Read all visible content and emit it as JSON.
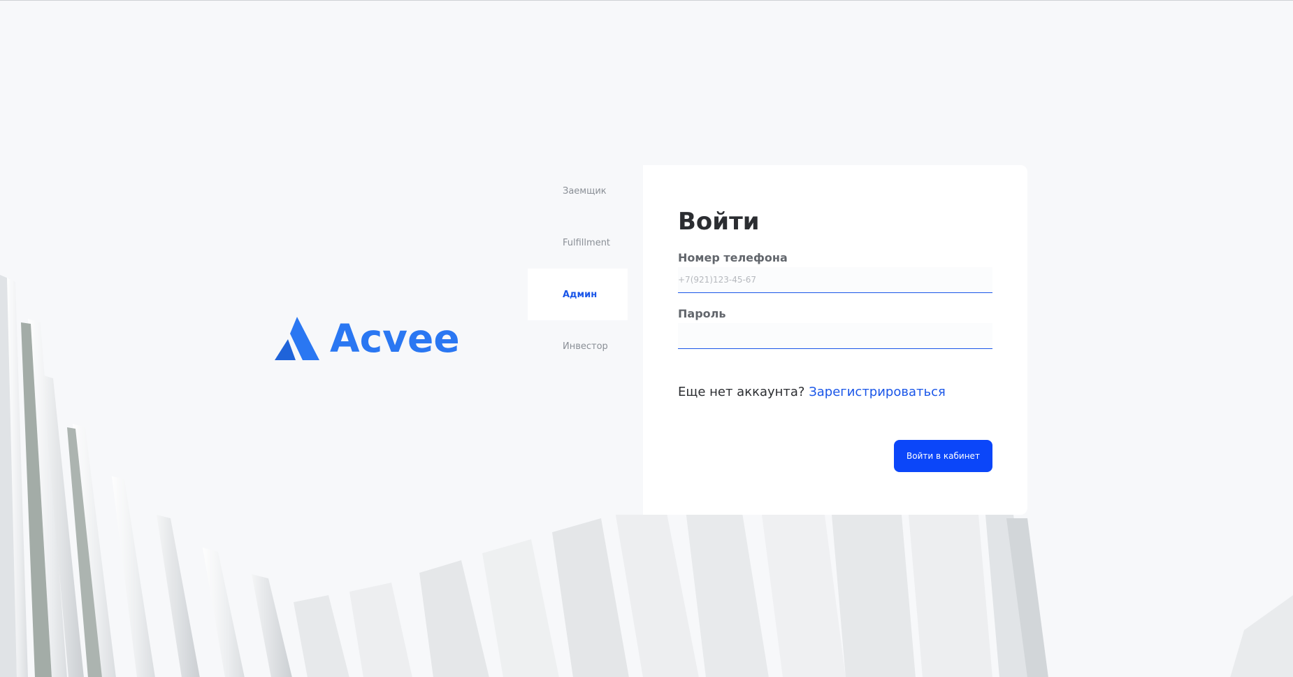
{
  "brand": {
    "name": "Acvee",
    "color": "#2a77f2",
    "icon": "acvee-logo-mark"
  },
  "tabs": [
    {
      "label": "Заемщик",
      "active": false
    },
    {
      "label": "Fulfillment",
      "active": false
    },
    {
      "label": "Админ",
      "active": true
    },
    {
      "label": "Инвестор",
      "active": false
    }
  ],
  "form": {
    "title": "Войти",
    "phone": {
      "label": "Номер телефона",
      "placeholder": "+7(921)123-45-67",
      "value": ""
    },
    "password": {
      "label": "Пароль",
      "placeholder": "",
      "value": ""
    },
    "register_prompt": "Еще нет аккаунта?",
    "register_link": "Зарегистрироваться",
    "submit_label": "Войти в кабинет"
  },
  "colors": {
    "accent": "#1a56e8",
    "button": "#0b46f9",
    "background": "#f7f8fa"
  }
}
